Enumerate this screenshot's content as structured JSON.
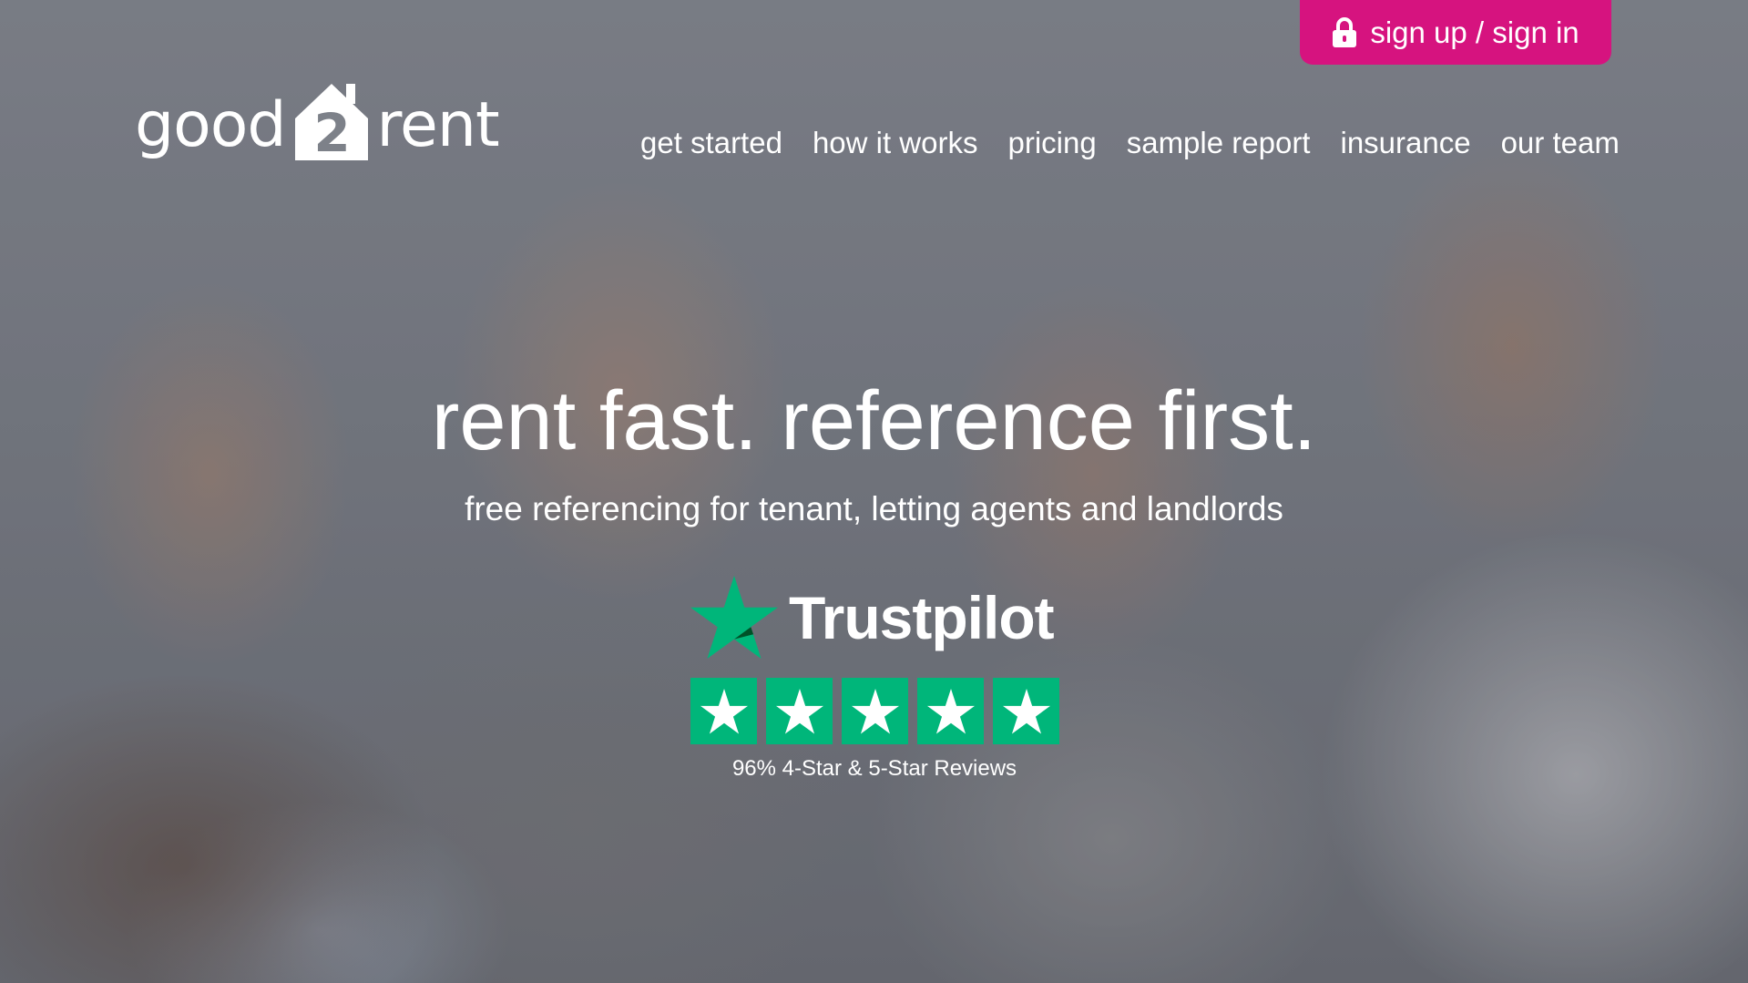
{
  "header": {
    "signin_label": "sign up / sign in",
    "signin_color": "#d6137f"
  },
  "logo": {
    "left_text": "good",
    "mark_text": "2",
    "right_text": "rent"
  },
  "nav": {
    "items": [
      {
        "label": "get started"
      },
      {
        "label": "how it works"
      },
      {
        "label": "pricing"
      },
      {
        "label": "sample report"
      },
      {
        "label": "insurance"
      },
      {
        "label": "our team"
      }
    ]
  },
  "hero": {
    "headline": "rent fast. reference first.",
    "subline": "free referencing for tenant, letting agents and landlords"
  },
  "trustpilot": {
    "brand": "Trustpilot",
    "stars": 5,
    "rating_color": "#00b67a",
    "caption": "96% 4-Star & 5-Star Reviews"
  }
}
